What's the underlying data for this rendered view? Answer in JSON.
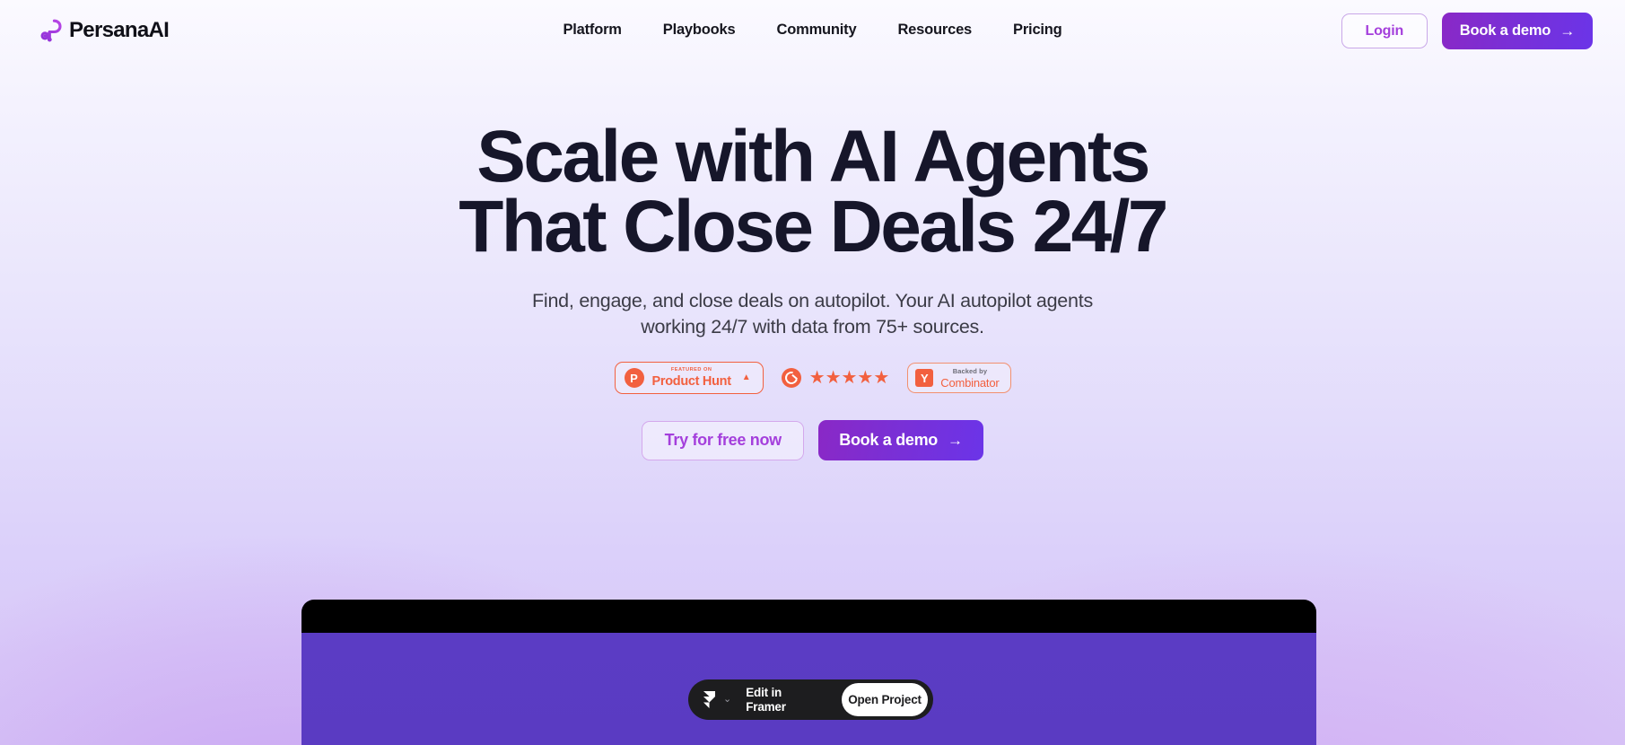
{
  "brand": {
    "name": "PersanaAI",
    "logo_icon": "persana-infinity-loop-icon",
    "accent_purple": "#7b2fd4",
    "accent_magenta": "#a43fdc",
    "accent_orange": "#f2603f"
  },
  "header": {
    "nav": [
      {
        "label": "Platform"
      },
      {
        "label": "Playbooks"
      },
      {
        "label": "Community"
      },
      {
        "label": "Resources"
      },
      {
        "label": "Pricing"
      }
    ],
    "login_label": "Login",
    "demo_label": "Book a demo",
    "demo_arrow": "→"
  },
  "hero": {
    "title_line1": "Scale with AI Agents",
    "title_line2": "That Close Deals 24/7",
    "sub_line1": "Find, engage, and close deals on autopilot. Your AI autopilot agents",
    "sub_line2": "working 24/7 with data from 75+ sources.",
    "cta_primary": "Try for free now",
    "cta_secondary": "Book a demo",
    "cta_secondary_arrow": "→"
  },
  "badges": {
    "product_hunt": {
      "mark": "P",
      "eyebrow": "FEATURED ON",
      "label": "Product Hunt",
      "caret": "▲"
    },
    "g2": {
      "logo_icon": "g2-logo-icon",
      "stars": "★★★★★",
      "rating": 5
    },
    "y_combinator": {
      "mark": "Y",
      "eyebrow": "Backed by",
      "label": "Combinator"
    }
  },
  "framer_badge": {
    "logo_icon": "framer-logo-icon",
    "chevron": "⌄",
    "label": "Edit in Framer",
    "open_label": "Open Project"
  }
}
